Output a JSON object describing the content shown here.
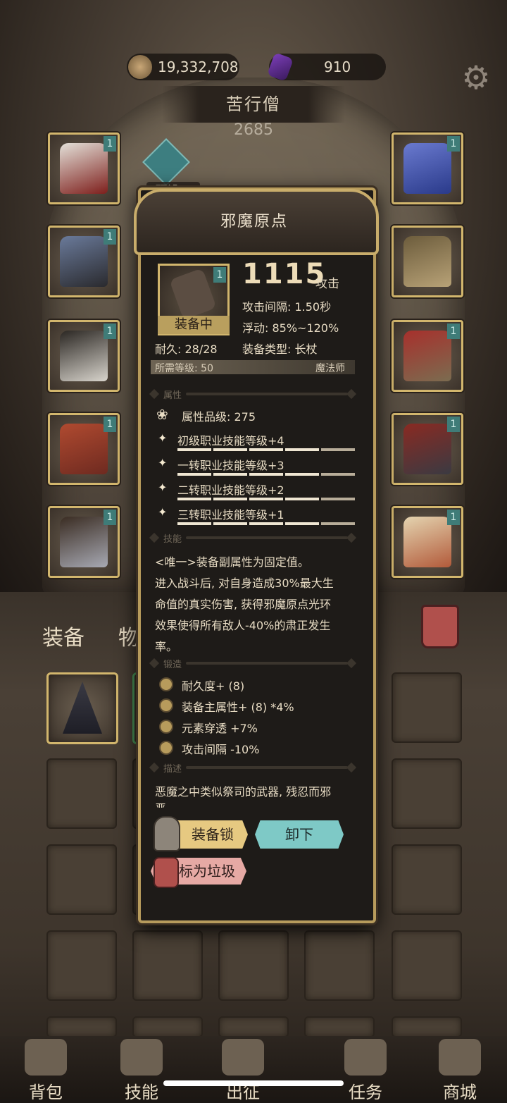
{
  "currency": {
    "gold": "19,332,708",
    "gems": "910"
  },
  "hero": {
    "name": "苦行僧",
    "power": "2685",
    "preset": "预设一"
  },
  "slots": {
    "left": [
      {
        "badge": "1",
        "color": "#7e1f1c",
        "accent": "#e3e0d8"
      },
      {
        "badge": "1",
        "color": "#2a2a2e",
        "accent": "#6a7a9a"
      },
      {
        "badge": "1",
        "color": "#d8d4cc",
        "accent": "#2a2622"
      },
      {
        "badge": "1",
        "color": "#6e2a20",
        "accent": "#b04a30"
      },
      {
        "badge": "1",
        "color": "#a7a9b3",
        "accent": "#3a2c22"
      }
    ],
    "right": [
      {
        "badge": "1",
        "color": "#2a3a8a",
        "accent": "#6a7acf"
      },
      {
        "badge": "",
        "color": "#b8a277",
        "accent": "#6c5c3c"
      },
      {
        "badge": "1",
        "color": "#7b6c50",
        "accent": "#a7302c"
      },
      {
        "badge": "1",
        "color": "#3a3a42",
        "accent": "#8a2a22"
      },
      {
        "badge": "1",
        "color": "#b25a3a",
        "accent": "#e4d4b0"
      }
    ]
  },
  "tabs": {
    "equip": "装备",
    "items": "物"
  },
  "nav": [
    "背包",
    "技能",
    "出征",
    "任务",
    "商城"
  ],
  "popup": {
    "title": "邪魔原点",
    "equipped": "装备中",
    "durability": "耐久: 28/28",
    "attack_value": "1115",
    "attack_unit": "攻击",
    "attack_interval": "攻击间隔: 1.50秒",
    "float": "浮动: 85%~120%",
    "type": "装备类型: 长杖",
    "required_level": "所需等级: 50",
    "class": "魔法师",
    "sec_attr": "属性",
    "attr_grade": "属性品级: 275",
    "attrs": [
      "初级职业技能等级+4",
      "一转职业技能等级+3",
      "二转职业技能等级+2",
      "三转职业技能等级+1"
    ],
    "sec_skill": "技能",
    "skill_lines": [
      "<唯一>装备副属性为固定值。",
      "进入战斗后, 对自身造成30%最大生",
      "命值的真实伤害, 获得邪魔原点光环",
      "效果使得所有敌人-40%的肃正发生",
      "率。"
    ],
    "sec_forge": "锻造",
    "forge": [
      "耐久度+ (8)",
      "装备主属性+ (8) *4%",
      "元素穿透 +7%",
      "攻击间隔 -10%"
    ],
    "sec_desc": "描述",
    "desc": "恶魔之中类似祭司的武器, 残忍而邪",
    "desc_cont": "恶",
    "btn_lock": "装备锁",
    "btn_unequip": "卸下",
    "btn_junk": "标为垃圾",
    "badge": "1"
  }
}
